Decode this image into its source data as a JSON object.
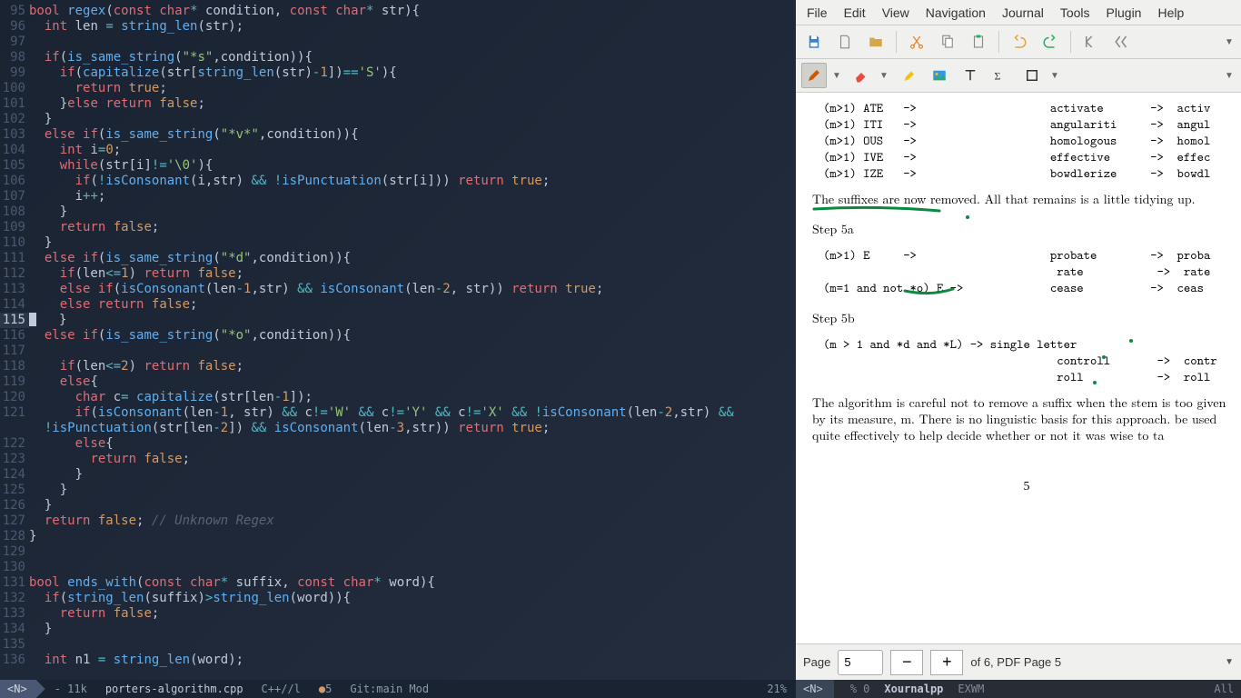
{
  "editor": {
    "lines": [
      {
        "n": 95,
        "html": "<span class='type'>bool</span> <span class='func'>regex</span>(<span class='kw'>const</span> <span class='type'>char</span><span class='op'>*</span> <span class='ident'>condition</span>, <span class='kw'>const</span> <span class='type'>char</span><span class='op'>*</span> <span class='ident'>str</span>){"
      },
      {
        "n": 96,
        "html": "  <span class='type'>int</span> <span class='ident'>len</span> <span class='op'>=</span> <span class='func'>string_len</span>(str);"
      },
      {
        "n": 97,
        "html": ""
      },
      {
        "n": 98,
        "html": "  <span class='kw'>if</span>(<span class='func'>is_same_string</span>(<span class='str'>\"*s\"</span>,condition)){"
      },
      {
        "n": 99,
        "html": "    <span class='kw'>if</span>(<span class='func'>capitalize</span>(str[<span class='func'>string_len</span>(str)<span class='op'>-</span><span class='num'>1</span>])<span class='op'>==</span><span class='char'>'S'</span>){"
      },
      {
        "n": 100,
        "html": "      <span class='kw'>return</span> <span class='bool'>true</span>;"
      },
      {
        "n": 101,
        "html": "    }<span class='kw'>else</span> <span class='kw'>return</span> <span class='bool'>false</span>;"
      },
      {
        "n": 102,
        "html": "  }"
      },
      {
        "n": 103,
        "html": "  <span class='kw'>else</span> <span class='kw'>if</span>(<span class='func'>is_same_string</span>(<span class='str'>\"*v*\"</span>,condition)){"
      },
      {
        "n": 104,
        "html": "    <span class='type'>int</span> <span class='ident'>i</span><span class='op'>=</span><span class='num'>0</span>;"
      },
      {
        "n": 105,
        "html": "    <span class='kw'>while</span>(str[i]<span class='op'>!=</span><span class='char'>'\\0'</span>){"
      },
      {
        "n": 106,
        "html": "      <span class='kw'>if</span>(<span class='op'>!</span><span class='func'>isConsonant</span>(i,str) <span class='op'>&amp;&amp;</span> <span class='op'>!</span><span class='func'>isPunctuation</span>(str[i])) <span class='kw'>return</span> <span class='bool'>true</span>;"
      },
      {
        "n": 107,
        "html": "      i<span class='op'>++</span>;"
      },
      {
        "n": 108,
        "html": "    }"
      },
      {
        "n": 109,
        "html": "    <span class='kw'>return</span> <span class='bool'>false</span>;"
      },
      {
        "n": 110,
        "html": "  }"
      },
      {
        "n": 111,
        "html": "  <span class='kw'>else</span> <span class='kw'>if</span>(<span class='func'>is_same_string</span>(<span class='str'>\"*d\"</span>,condition)){"
      },
      {
        "n": 112,
        "html": "    <span class='kw'>if</span>(len<span class='op'>&lt;=</span><span class='num'>1</span>) <span class='kw'>return</span> <span class='bool'>false</span>;"
      },
      {
        "n": 113,
        "html": "    <span class='kw'>else</span> <span class='kw'>if</span>(<span class='func'>isConsonant</span>(len<span class='op'>-</span><span class='num'>1</span>,str) <span class='op'>&amp;&amp;</span> <span class='func'>isConsonant</span>(len<span class='op'>-</span><span class='num'>2</span>, str)) <span class='kw'>return</span> <span class='bool'>true</span>;"
      },
      {
        "n": 114,
        "html": "    <span class='kw'>else</span> <span class='kw'>return</span> <span class='bool'>false</span>;"
      },
      {
        "n": 115,
        "cursor": true,
        "html": "  }"
      },
      {
        "n": 116,
        "html": "  <span class='kw'>else</span> <span class='kw'>if</span>(<span class='func'>is_same_string</span>(<span class='str'>\"*o\"</span>,condition)){"
      },
      {
        "n": 117,
        "html": ""
      },
      {
        "n": 118,
        "html": "    <span class='kw'>if</span>(len<span class='op'>&lt;=</span><span class='num'>2</span>) <span class='kw'>return</span> <span class='bool'>false</span>;"
      },
      {
        "n": 119,
        "html": "    <span class='kw'>else</span>{"
      },
      {
        "n": 120,
        "html": "      <span class='type'>char</span> <span class='ident'>c</span><span class='op'>=</span> <span class='func'>capitalize</span>(str[len<span class='op'>-</span><span class='num'>1</span>]);"
      },
      {
        "n": 121,
        "html": "      <span class='kw'>if</span>(<span class='func'>isConsonant</span>(len<span class='op'>-</span><span class='num'>1</span>, str) <span class='op'>&amp;&amp;</span> c<span class='op'>!=</span><span class='char'>'W'</span> <span class='op'>&amp;&amp;</span> c<span class='op'>!=</span><span class='char'>'Y'</span> <span class='op'>&amp;&amp;</span> c<span class='op'>!=</span><span class='char'>'X'</span> <span class='op'>&amp;&amp;</span> <span class='op'>!</span><span class='func'>isConsonant</span>(len<span class='op'>-</span><span class='num'>2</span>,str) <span class='op'>&amp;&amp;</span>\n  <span class='op'>!</span><span class='func'>isPunctuation</span>(str[len<span class='op'>-</span><span class='num'>2</span>]) <span class='op'>&amp;&amp;</span> <span class='func'>isConsonant</span>(len<span class='op'>-</span><span class='num'>3</span>,str)) <span class='kw'>return</span> <span class='bool'>true</span>;"
      },
      {
        "n": 122,
        "html": "      <span class='kw'>else</span>{"
      },
      {
        "n": 123,
        "html": "        <span class='kw'>return</span> <span class='bool'>false</span>;"
      },
      {
        "n": 124,
        "html": "      }"
      },
      {
        "n": 125,
        "html": "    }"
      },
      {
        "n": 126,
        "html": "  }"
      },
      {
        "n": 127,
        "html": "  <span class='kw'>return</span> <span class='bool'>false</span>; <span class='cmt'>// Unknown Regex</span>"
      },
      {
        "n": 128,
        "html": "}"
      },
      {
        "n": 129,
        "html": ""
      },
      {
        "n": 130,
        "html": ""
      },
      {
        "n": 131,
        "html": "<span class='type'>bool</span> <span class='func'>ends_with</span>(<span class='kw'>const</span> <span class='type'>char</span><span class='op'>*</span> <span class='ident'>suffix</span>, <span class='kw'>const</span> <span class='type'>char</span><span class='op'>*</span> <span class='ident'>word</span>){"
      },
      {
        "n": 132,
        "html": "  <span class='kw'>if</span>(<span class='func'>string_len</span>(suffix)<span class='op'>&gt;</span><span class='func'>string_len</span>(word)){"
      },
      {
        "n": 133,
        "html": "    <span class='kw'>return</span> <span class='bool'>false</span>;"
      },
      {
        "n": 134,
        "html": "  }"
      },
      {
        "n": 135,
        "html": ""
      },
      {
        "n": 136,
        "html": "  <span class='type'>int</span> <span class='ident'>n1</span> <span class='op'>=</span> <span class='func'>string_len</span>(word);"
      }
    ],
    "statusline": {
      "mode": "<N>",
      "size": "11k",
      "filename": "porters-algorithm.cpp",
      "lang": "C++//l",
      "diag": "5",
      "git": "Git:main Mod",
      "percent": "21%"
    }
  },
  "viewer": {
    "menus": [
      "File",
      "Edit",
      "View",
      "Navigation",
      "Journal",
      "Tools",
      "Plugin",
      "Help"
    ],
    "pagebar": {
      "label": "Page",
      "current": "5",
      "of": "of 6, PDF Page 5"
    },
    "statusline": {
      "mode": "<N>",
      "pct": "% 0",
      "app": "Xournalpp",
      "wm": "EXWM",
      "right": "All"
    },
    "doc": {
      "rows1": [
        "(m>1) ATE   ->                    activate       ->  activ",
        "(m>1) ITI   ->                    angulariti     ->  angul",
        "(m>1) OUS   ->                    homologous     ->  homol",
        "(m>1) IVE   ->                    effective      ->  effec",
        "(m>1) IZE   ->                    bowdlerize     ->  bowdl"
      ],
      "sentence1": "The suffixes are now removed.  All that remains is a little tidying up.",
      "step5a": "Step 5a",
      "rows5a": [
        "(m>1) E     ->                    probate        ->  proba",
        "                                   rate           ->  rate",
        "(m=1 and not *o) E ->             cease          ->  ceas"
      ],
      "step5b": "Step 5b",
      "rows5b": [
        "(m > 1 and *d and *L) -> single letter",
        "                                   controll       ->  contr",
        "                                   roll           ->  roll"
      ],
      "para": "The algorithm is careful not to remove a suffix when the stem is too given by its measure, m.  There is no linguistic basis for this approach. be used quite effectively to help decide whether or not it was wise to ta",
      "pagenum": "5"
    }
  }
}
